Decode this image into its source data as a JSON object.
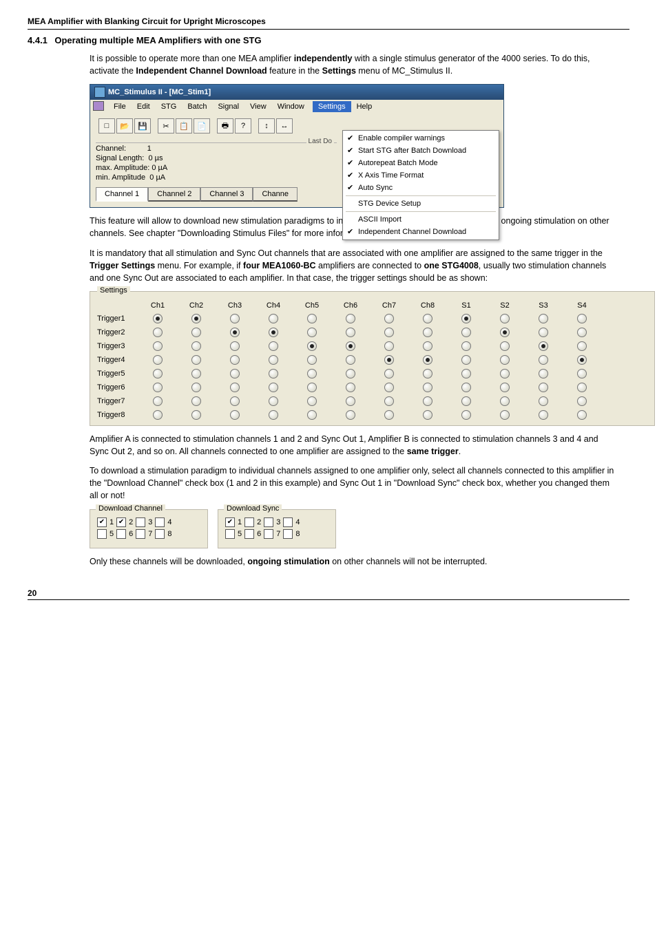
{
  "header": "MEA Amplifier with Blanking Circuit for Upright Microscopes",
  "section_num": "4.4.1",
  "section_title": "Operating multiple MEA Amplifiers with one STG",
  "p1a": "It is possible to operate more than one MEA amplifier ",
  "p1b": "independently",
  "p1c": " with a single stimulus generator of the 4000 series. To do this, activate the ",
  "p1d": "Independent Channel Download",
  "p1e": " feature in the ",
  "p1f": "Settings",
  "p1g": " menu of MC_Stimulus II.",
  "win1": {
    "title": "MC_Stimulus II - [MC_Stim1]",
    "menu": [
      "File",
      "Edit",
      "STG",
      "Batch",
      "Signal",
      "View",
      "Window",
      "Settings",
      "Help"
    ],
    "tool_icons": [
      "□",
      "📂",
      "💾",
      "✂",
      "📋",
      "📄",
      "🖶",
      "?",
      "↕",
      "↔"
    ],
    "channel_label": "Channel:",
    "channel_val": "1",
    "siglen_label": "Signal Length:",
    "siglen_val": "0 µs",
    "maxamp_label": "max. Amplitude:",
    "maxamp_val": "0 µA",
    "minamp_label": "min. Amplitude",
    "minamp_val": "0 µA",
    "lastd": "Last Do",
    "tabs": [
      "Channel 1",
      "Channel 2",
      "Channel 3",
      "Channe"
    ],
    "dropdown": [
      {
        "label": "Enable compiler warnings",
        "chk": true
      },
      {
        "label": "Start STG after Batch Download",
        "chk": true
      },
      {
        "label": "Autorepeat Batch Mode",
        "chk": true
      },
      {
        "label": "X Axis Time Format",
        "chk": true
      },
      {
        "label": "Auto Sync",
        "chk": true
      },
      {
        "label": "STG Device Setup",
        "chk": false
      },
      {
        "label": "ASCII Import",
        "chk": false
      },
      {
        "label": "Independent Channel Download",
        "chk": true
      }
    ]
  },
  "p2": "This feature will allow to download new stimulation paradigms to individual channels without interrupting the ongoing stimulation on other channels. See chapter \"Downloading Stimulus Files\" for more information.",
  "p3a": "It is mandatory that all stimulation and Sync Out channels that are associated with one amplifier are assigned to the same trigger in the ",
  "p3b": "Trigger Settings",
  "p3c": " menu. For example, if ",
  "p3d": "four MEA1060-BC",
  "p3e": " amplifiers are connected to ",
  "p3f": "one STG4008",
  "p3g": ", usually two stimulation channels and one Sync Out are associated to each amplifier. In that case, the trigger settings should be as shown:",
  "settings": {
    "legend": "Settings",
    "cols": [
      "Ch1",
      "Ch2",
      "Ch3",
      "Ch4",
      "Ch5",
      "Ch6",
      "Ch7",
      "Ch8",
      "S1",
      "S2",
      "S3",
      "S4"
    ],
    "rows": [
      "Trigger1",
      "Trigger2",
      "Trigger3",
      "Trigger4",
      "Trigger5",
      "Trigger6",
      "Trigger7",
      "Trigger8"
    ],
    "sel": {
      "Trigger1": [
        0,
        1,
        8
      ],
      "Trigger2": [
        2,
        3,
        9
      ],
      "Trigger3": [
        4,
        5,
        10
      ],
      "Trigger4": [
        6,
        7,
        11
      ]
    }
  },
  "p4a": "Amplifier A is connected to stimulation channels 1 and 2 and Sync Out 1, Amplifier B is connected to stimulation channels 3 and 4 and Sync Out 2, and so on. All channels connected to one amplifier are assigned to the ",
  "p4b": "same trigger",
  "p4c": ".",
  "p5": "To download a stimulation paradigm to individual channels assigned to one amplifier only, select all channels connected to this amplifier in the \"Download Channel\" check box (1 and 2 in this example) and Sync Out 1 in \"Download Sync\" check box, whether you changed them all or not!",
  "dl": {
    "ch_legend": "Download Channel",
    "sync_legend": "Download Sync",
    "labels": [
      "1",
      "2",
      "3",
      "4",
      "5",
      "6",
      "7",
      "8"
    ],
    "ch_checked": [
      true,
      true,
      false,
      false,
      false,
      false,
      false,
      false
    ],
    "sync_checked": [
      true,
      false,
      false,
      false,
      false,
      false,
      false,
      false
    ]
  },
  "p6a": "Only these channels will be downloaded, ",
  "p6b": "ongoing stimulation",
  "p6c": " on other channels will not be interrupted.",
  "page_num": "20"
}
